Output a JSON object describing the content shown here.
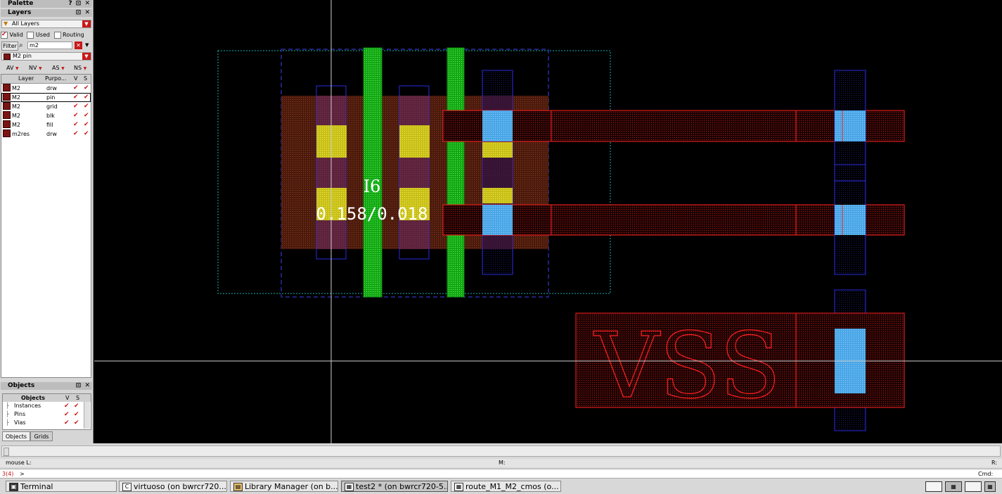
{
  "palette": {
    "title": "Palette",
    "buttons": "? ⊡ ✕"
  },
  "layers": {
    "title": "Layers",
    "buttons": "⊡ ✕",
    "scope": "All Layers",
    "filters": {
      "valid": "Valid",
      "used": "Used",
      "routing": "Routing"
    },
    "filter_button": "Filter",
    "search_value": "m2",
    "current_layer": "M2 pin",
    "visibility_toggles": [
      "AV",
      "NV",
      "AS",
      "NS"
    ],
    "columns": [
      "Layer",
      "Purpo...",
      "V",
      "S"
    ],
    "rows": [
      {
        "layer": "M2",
        "purpose": "drw"
      },
      {
        "layer": "M2",
        "purpose": "pin"
      },
      {
        "layer": "M2",
        "purpose": "grid"
      },
      {
        "layer": "M2",
        "purpose": "blk"
      },
      {
        "layer": "M2",
        "purpose": "fill"
      },
      {
        "layer": "m2res",
        "purpose": "drw"
      }
    ]
  },
  "objects": {
    "title": "Objects",
    "buttons": "⊡ ✕",
    "columns": [
      "Objects",
      "V",
      "S"
    ],
    "rows": [
      "Instances",
      "Pins",
      "Vias"
    ],
    "tabs": [
      "Objects",
      "Grids"
    ]
  },
  "canvas": {
    "instance_name": "I6",
    "instance_params": "0.158/0.018",
    "pin_label": "VSS",
    "colors": {
      "m1": "#e8e01e",
      "m2": "#e01818",
      "poly": "#18d818",
      "via": "#5ab4f0",
      "diff": "#7a2a1a"
    }
  },
  "status": {
    "mouse_left": "mouse L:",
    "mouse_middle": "M:",
    "mouse_right": "R:",
    "prompt_count": "3(4)",
    "prompt_symbol": ">",
    "cmd_label": "Cmd:"
  },
  "taskbar": [
    {
      "label": "Terminal",
      "icon": "terminal-icon"
    },
    {
      "label": "virtuoso (on bwrcr720...",
      "icon": "cadence-icon"
    },
    {
      "label": "Library Manager (on b...",
      "icon": "library-icon"
    },
    {
      "label": "test2 * (on bwrcr720-5...",
      "icon": "layout-icon"
    },
    {
      "label": "route_M1_M2_cmos (o...",
      "icon": "layout-icon"
    }
  ]
}
